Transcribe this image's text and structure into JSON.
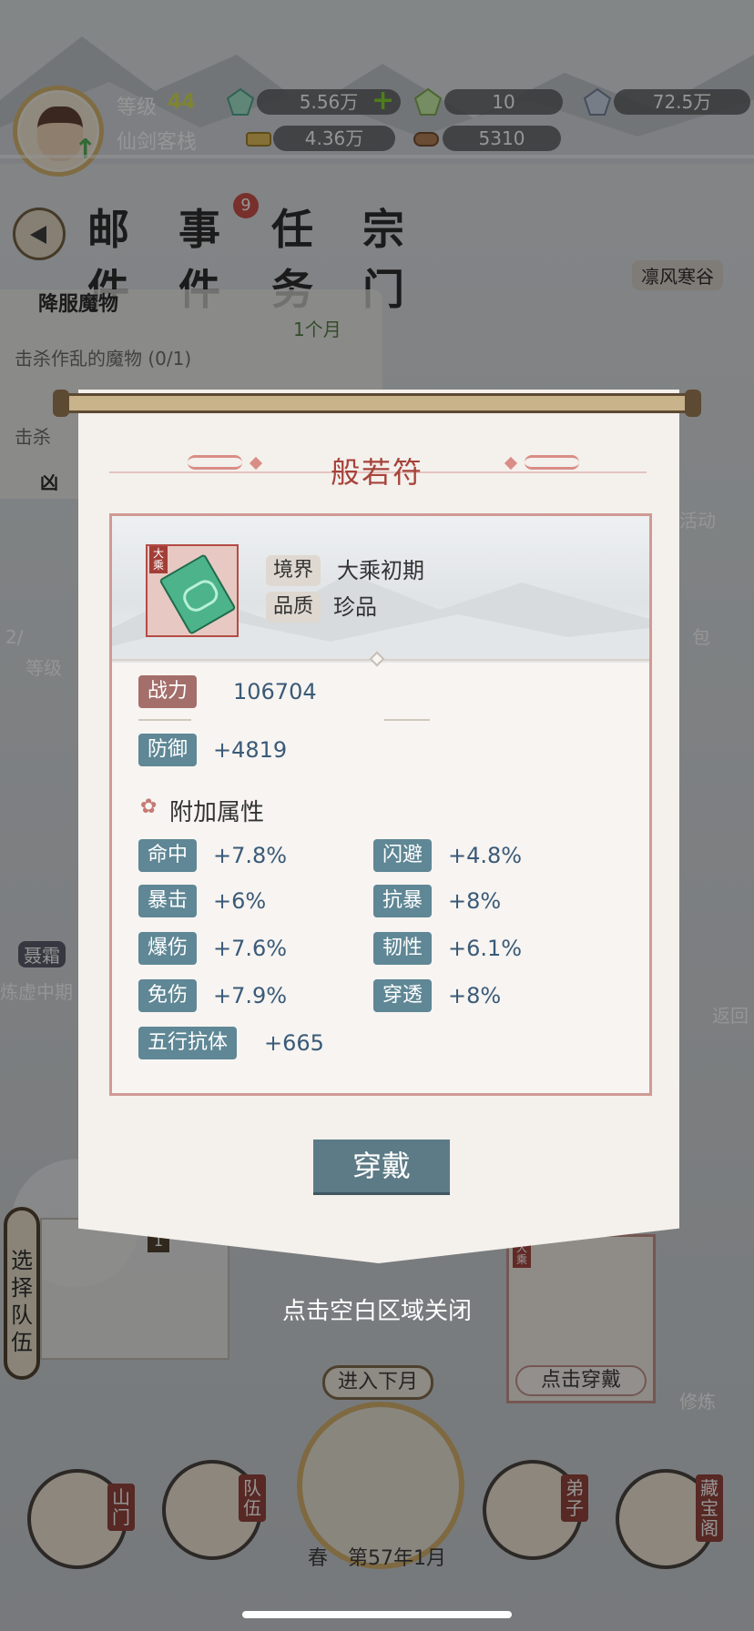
{
  "player": {
    "level_label": "等级",
    "level": "44",
    "inn_name": "仙剑客栈",
    "avatar_badge": "Up"
  },
  "resources": {
    "spirit_stone": "5.56万",
    "special_stone": "10",
    "crystal": "72.5万",
    "gold": "4.36万",
    "wood": "5310"
  },
  "menu": {
    "mail": "邮件",
    "events": "事件",
    "events_badge": "9",
    "tasks": "任务",
    "clan": "宗门"
  },
  "quest": {
    "title": "降服魔物",
    "progress_label": "1个月",
    "desc": "击杀作乱的魔物 (0/1)",
    "desc2": "击杀",
    "title3": "凶"
  },
  "region": "凛风寒谷",
  "side": {
    "event_label": "活动",
    "bag_label": "包",
    "level_label": "等级",
    "progress": "2/",
    "npc_name": "聂霜",
    "npc_realm": "炼虚中期",
    "return_label": "返回"
  },
  "modal": {
    "title": "般若符",
    "item_tag": "大乘",
    "realm_label": "境界",
    "realm_value": "大乘初期",
    "quality_label": "品质",
    "quality_value": "珍品",
    "power_label": "战力",
    "power_value": "106704",
    "defense_label": "防御",
    "defense_value": "+4819",
    "extra_title": "附加属性",
    "attrs": [
      {
        "label": "命中",
        "value": "+7.8%"
      },
      {
        "label": "闪避",
        "value": "+4.8%"
      },
      {
        "label": "暴击",
        "value": "+6%"
      },
      {
        "label": "抗暴",
        "value": "+8%"
      },
      {
        "label": "爆伤",
        "value": "+7.6%"
      },
      {
        "label": "韧性",
        "value": "+6.1%"
      },
      {
        "label": "免伤",
        "value": "+7.9%"
      },
      {
        "label": "穿透",
        "value": "+8%"
      }
    ],
    "wuxing_label": "五行抗体",
    "wuxing_value": "+665",
    "wear_button": "穿戴"
  },
  "hint": "点击空白区域关闭",
  "team": {
    "select_label": "选择队伍",
    "slot_badge": "1"
  },
  "equip_box": {
    "tag": "大乘",
    "button": "点击穿戴"
  },
  "bottom": {
    "next_month": "进入下月",
    "season": "春",
    "year_month": "第57年1月",
    "gate": "山门",
    "team": "队伍",
    "disciples": "弟子",
    "treasure": "藏宝阁",
    "cultivate": "修炼"
  },
  "colors": {
    "modal_title": "#a6433a",
    "tag_blue": "#5f8795",
    "tag_red": "#a46e6a",
    "value_blue": "#3a5a78",
    "level_yellow": "#d8e046"
  }
}
